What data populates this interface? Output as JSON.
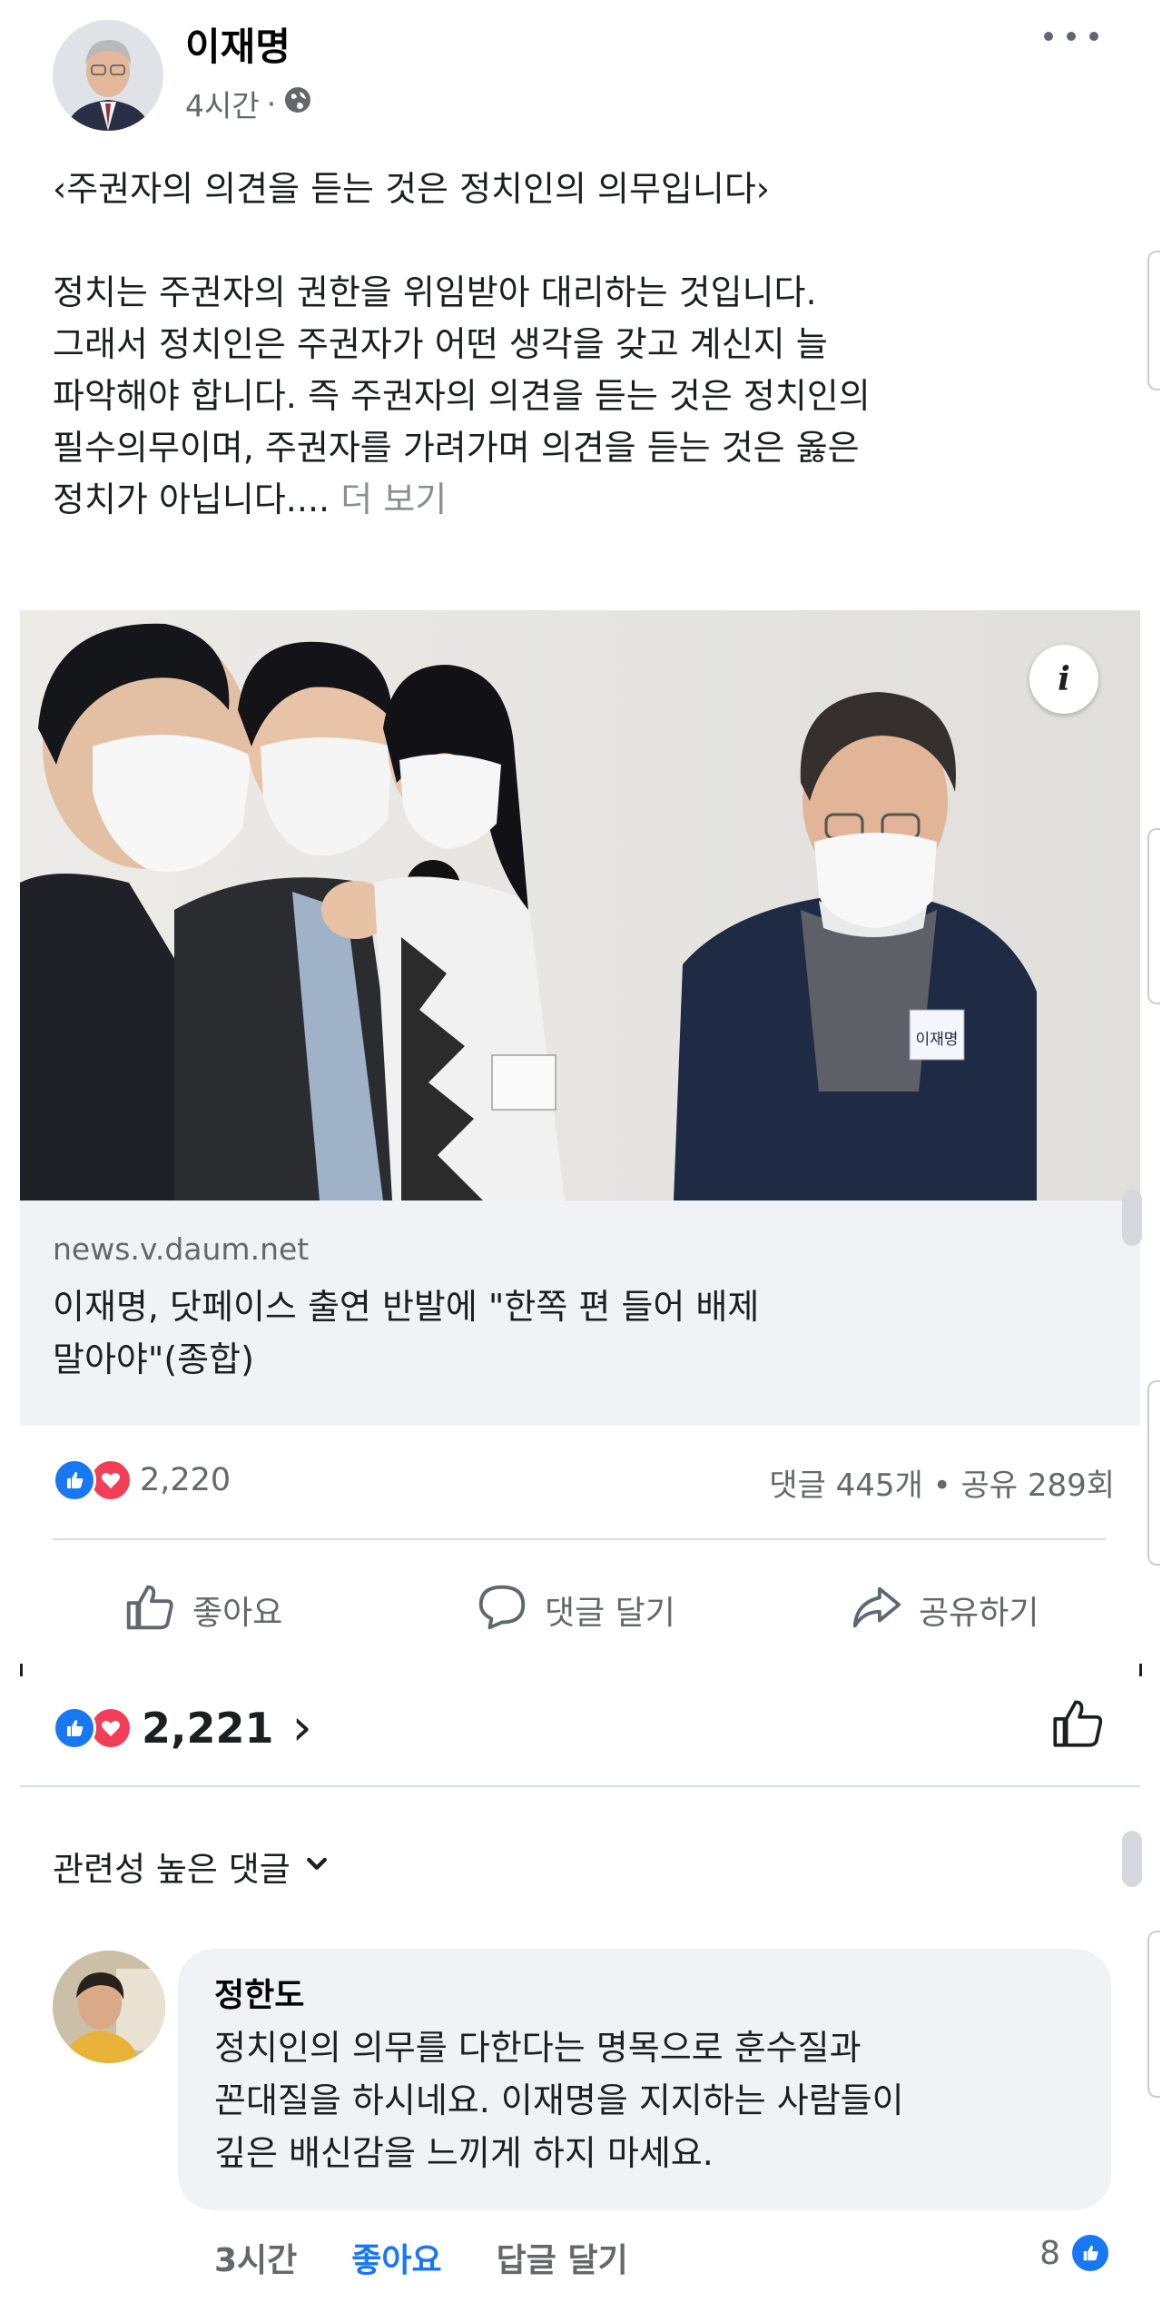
{
  "post": {
    "author": "이재명",
    "time": "4시간",
    "separator": "·",
    "privacy_icon": "globe-icon",
    "title_line": "‹주권자의 의견을 듣는 것은 정치인의 의무입니다›",
    "body_lines": [
      "정치는 주권자의 권한을 위임받아 대리하는 것입니다.",
      "그래서 정치인은 주권자가 어떤 생각을 갖고 계신지 늘",
      "파악해야 합니다. 즉 주권자의 의견을 듣는 것은 정치인의",
      "필수의무이며, 주권자를 가려가며 의견을 듣는 것은 옳은"
    ],
    "last_line": "정치가 아닙니다....",
    "see_more": "더 보기"
  },
  "link": {
    "info_glyph": "i",
    "name_tag": "이재명",
    "domain": "news.v.daum.net",
    "headline_line1": "이재명, 닷페이스 출연 반발에 \"한쪽 편 들어 배제",
    "headline_line2": "말아야\"(종합)"
  },
  "stats": {
    "reactions": "2,220",
    "comments_shares": "댓글 445개 • 공유 289회"
  },
  "actions": {
    "like": "좋아요",
    "comment": "댓글 달기",
    "share": "공유하기"
  },
  "summary": {
    "reactions": "2,221",
    "chevron": "›"
  },
  "comments": {
    "sort_label": "관련성 높은 댓글",
    "items": [
      {
        "name": "정한도",
        "lines": [
          "정치인의 의무를 다한다는 명목으로 훈수질과",
          "꼰대질을 하시네요. 이재명을 지지하는 사람들이",
          "깊은 배신감을 느끼게 하지 마세요."
        ],
        "time": "3시간",
        "like": "좋아요",
        "reply": "답글 달기",
        "like_count": "8"
      }
    ]
  },
  "colors": {
    "like_blue": "#1877f2",
    "love_red": "#f33e58",
    "muted_text": "#65676b",
    "card_bg": "#f0f2f5"
  }
}
